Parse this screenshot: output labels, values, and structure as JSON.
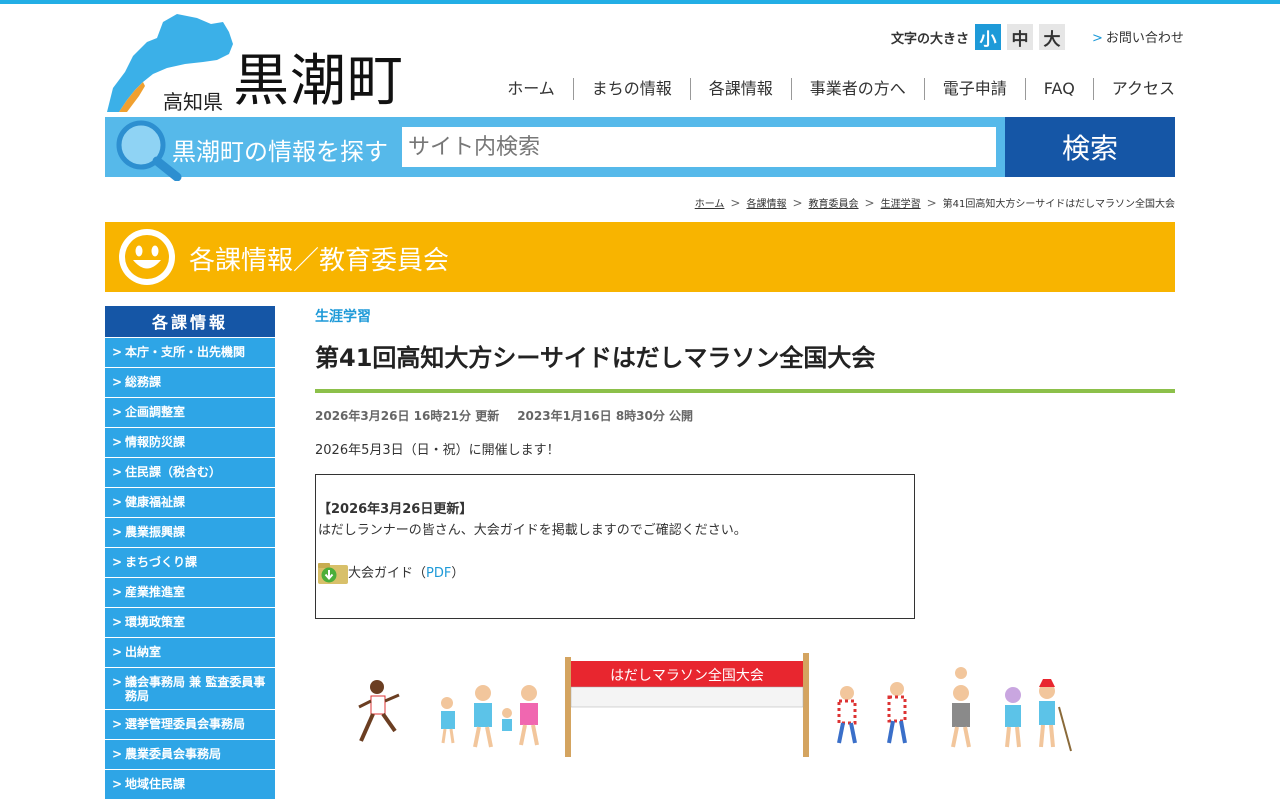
{
  "header": {
    "pref_name": "高知県",
    "town_name": "黒潮町",
    "font_size_label": "文字の大きさ",
    "font_sizes": [
      "小",
      "中",
      "大"
    ],
    "contact_label": "お問い合わせ",
    "nav": [
      "ホーム",
      "まちの情報",
      "各課情報",
      "事業者の方へ",
      "電子申請",
      "FAQ",
      "アクセス"
    ]
  },
  "search": {
    "label": "黒潮町の情報を探す",
    "placeholder": "サイト内検索",
    "button": "検索"
  },
  "breadcrumb": [
    "ホーム",
    "各課情報",
    "教育委員会",
    "生涯学習",
    "第41回高知大方シーサイドはだしマラソン全国大会"
  ],
  "banner": {
    "title": "各課情報／教育委員会"
  },
  "sidebar": {
    "heading": "各課情報",
    "items": [
      "本庁・支所・出先機関",
      "総務課",
      "企画調整室",
      "情報防災課",
      "住民課（税含む）",
      "健康福祉課",
      "農業振興課",
      "まちづくり課",
      "産業推進室",
      "環境政策室",
      "出納室",
      "議会事務局 兼 監査委員事務局",
      "選挙管理委員会事務局",
      "農業委員会事務局",
      "地域住民課"
    ]
  },
  "article": {
    "category": "生涯学習",
    "title": "第41回高知大方シーサイドはだしマラソン全国大会",
    "updated": "2026年3月26日 16時21分 更新",
    "published": "2023年1月16日 8時30分 公開",
    "lead": "2026年5月3日（日・祝）に開催します！",
    "notice_title": "【2026年3月26日更新】",
    "notice_text": "はだしランナーの皆さん、大会ガイドを掲載しますのでご確認ください。",
    "file_label": "大会ガイド（",
    "file_type": "PDF",
    "file_close": "）",
    "banner_text": "はだしマラソン全国大会"
  },
  "colors": {
    "accent": "#1e9ad8",
    "search_bg": "#56b9ea",
    "search_button": "#1556a6",
    "banner": "#f8b400",
    "sidebar": "#2ea5e6",
    "rule": "#8cc04a"
  }
}
